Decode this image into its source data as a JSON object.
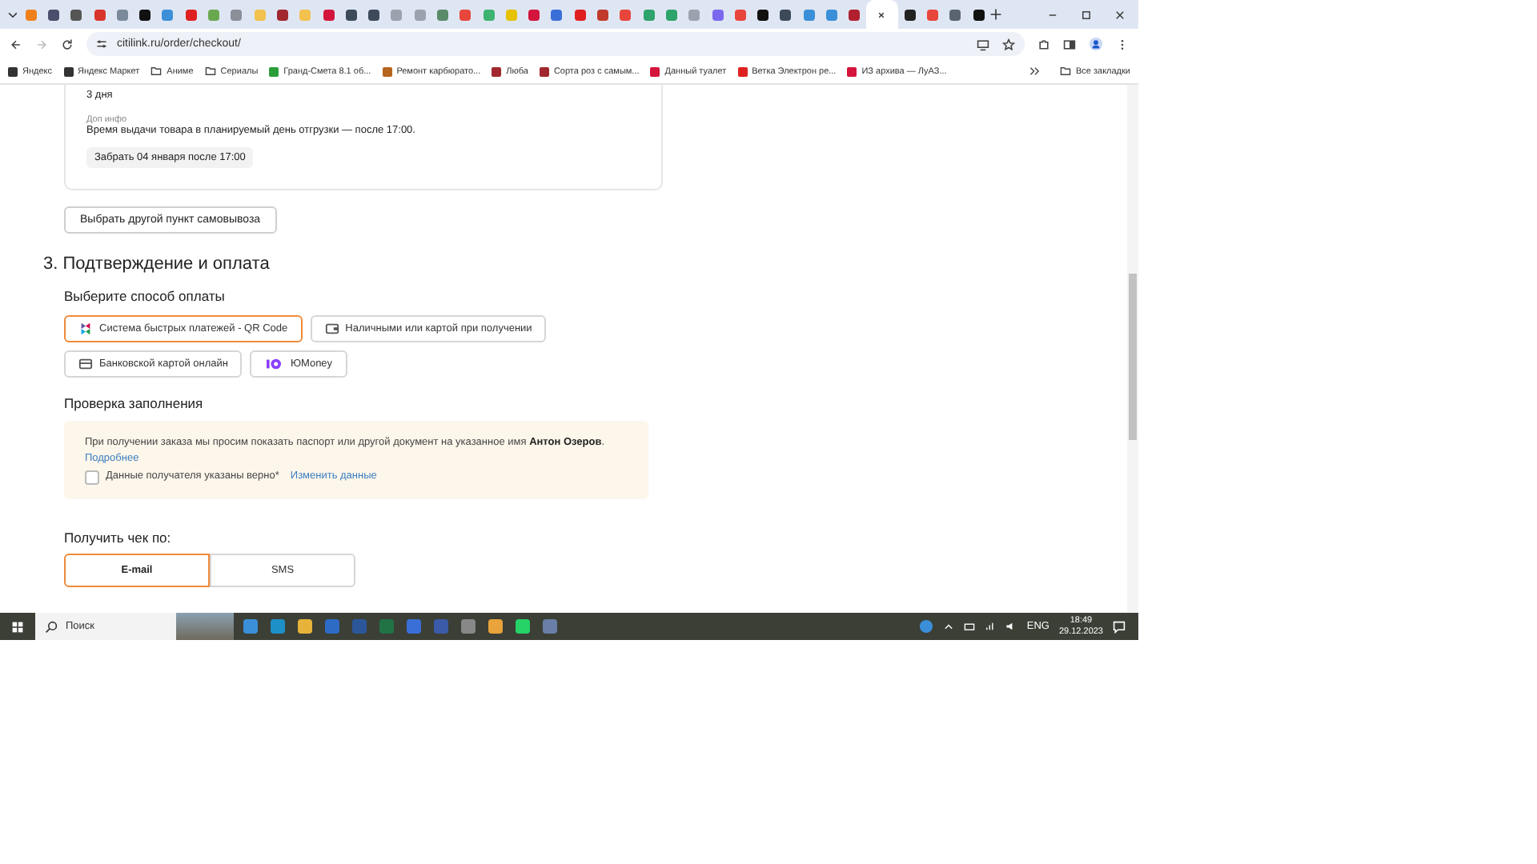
{
  "tabs": [
    {
      "color": "#f0811a",
      "selected": false
    },
    {
      "color": "#4a4f6b",
      "selected": false
    },
    {
      "color": "#555555",
      "selected": false
    },
    {
      "color": "#d9342b",
      "selected": false
    },
    {
      "color": "#7a8a9a",
      "selected": false
    },
    {
      "color": "#111111",
      "selected": false
    },
    {
      "color": "#3d8fd8",
      "selected": false
    },
    {
      "color": "#e02020",
      "selected": false
    },
    {
      "color": "#6aa84f",
      "selected": false
    },
    {
      "color": "#8a8f98",
      "selected": false
    },
    {
      "color": "#f2c14e",
      "selected": false
    },
    {
      "color": "#a0282e",
      "selected": false
    },
    {
      "color": "#f2c14e",
      "selected": false
    },
    {
      "color": "#d3143c",
      "selected": false
    },
    {
      "color": "#3c4a5a",
      "selected": false
    },
    {
      "color": "#3c4a5a",
      "selected": false
    },
    {
      "color": "#9aa3ad",
      "selected": false
    },
    {
      "color": "#9aa3ad",
      "selected": false
    },
    {
      "color": "#5b8a6a",
      "selected": false
    },
    {
      "color": "#e8453c",
      "selected": false
    },
    {
      "color": "#3cb371",
      "selected": false
    },
    {
      "color": "#e6c200",
      "selected": false
    },
    {
      "color": "#d3143c",
      "selected": false
    },
    {
      "color": "#3a6fd8",
      "selected": false
    },
    {
      "color": "#e02020",
      "selected": false
    },
    {
      "color": "#c0392b",
      "selected": false
    },
    {
      "color": "#e8453c",
      "selected": false
    },
    {
      "color": "#2ea36b",
      "selected": false
    },
    {
      "color": "#2ea36b",
      "selected": false
    },
    {
      "color": "#9aa3ad",
      "selected": false
    },
    {
      "color": "#7b68ee",
      "selected": false
    },
    {
      "color": "#e8453c",
      "selected": false
    },
    {
      "color": "#111111",
      "selected": false
    },
    {
      "color": "#3c4a5a",
      "selected": false
    },
    {
      "color": "#3a8fd8",
      "selected": false
    },
    {
      "color": "#3a8fd8",
      "selected": false
    },
    {
      "color": "#b0202e",
      "selected": false
    },
    {
      "selected": true
    },
    {
      "color": "#222222",
      "selected": false
    },
    {
      "color": "#e8453c",
      "selected": false
    },
    {
      "color": "#5a6470",
      "selected": false
    },
    {
      "color": "#111111",
      "selected": false
    }
  ],
  "address": "citilink.ru/order/checkout/",
  "bookmarks": [
    {
      "kind": "site",
      "label": "Яндекс",
      "color": "#333333"
    },
    {
      "kind": "site",
      "label": "Яндекс Маркет",
      "color": "#333333"
    },
    {
      "kind": "folder",
      "label": "Аниме"
    },
    {
      "kind": "folder",
      "label": "Сериалы"
    },
    {
      "kind": "site",
      "label": "Гранд-Смета 8.1 об...",
      "color": "#2a9d3a"
    },
    {
      "kind": "site",
      "label": "Ремонт карбюрато...",
      "color": "#b5651d"
    },
    {
      "kind": "site",
      "label": "Люба",
      "color": "#a0282e"
    },
    {
      "kind": "site",
      "label": "Сорта роз с самым...",
      "color": "#a0282e"
    },
    {
      "kind": "site",
      "label": "Данный туалет",
      "color": "#d3143c"
    },
    {
      "kind": "site",
      "label": "Ветка Электрон ре...",
      "color": "#e02020"
    },
    {
      "kind": "site",
      "label": "ИЗ архива — ЛуАЗ...",
      "color": "#d3143c"
    }
  ],
  "all_bookmarks": "Все закладки",
  "pickup": {
    "storage_value": "3 дня",
    "extra_label": "Доп инфо",
    "extra_text": "Время выдачи товара в планируемый день отгрузки — после 17:00.",
    "pickup_chip": "Забрать 04 января после 17:00",
    "change_button": "Выбрать другой пункт самовывоза"
  },
  "section_title": "3. Подтверждение и оплата",
  "payment_title": "Выберите способ оплаты",
  "payment_methods": [
    {
      "kind": "sbp",
      "label": "Система быстрых платежей - QR Code",
      "selected": true
    },
    {
      "kind": "cash",
      "label": "Наличными или картой при получении",
      "selected": false
    },
    {
      "kind": "card",
      "label": "Банковской картой онлайн",
      "selected": false
    },
    {
      "kind": "yoomoney",
      "label": "ЮMoney",
      "selected": false
    }
  ],
  "check_title": "Проверка заполнения",
  "notice": {
    "text": "При получении заказа мы просим показать паспорт или другой документ на указанное имя **Антон Озеров**.",
    "link": "Подробнее",
    "checkbox_label": "Данные получателя указаны верно*",
    "checked": false,
    "edit_link": "Изменить данные"
  },
  "receipt_title": "Получить чек по:",
  "receipt_options": [
    {
      "label": "E-mail",
      "selected": true
    },
    {
      "label": "SMS",
      "selected": false
    }
  ],
  "taskbar": {
    "search_placeholder": "Поиск",
    "language": "ENG",
    "time": "18:49",
    "date": "29.12.2023"
  }
}
